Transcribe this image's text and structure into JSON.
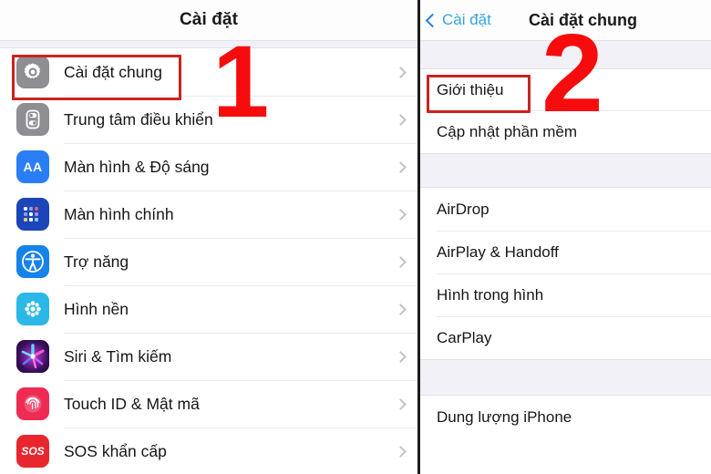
{
  "left_panel": {
    "nav": {
      "title": "Cài đặt"
    },
    "rows": [
      {
        "label": "Cài đặt chung",
        "icon": "gear-icon"
      },
      {
        "label": "Trung tâm điều khiển",
        "icon": "control-center-icon"
      },
      {
        "label": "Màn hình & Độ sáng",
        "icon": "display-brightness-icon",
        "icon_text": "AA"
      },
      {
        "label": "Màn hình chính",
        "icon": "home-screen-icon"
      },
      {
        "label": "Trợ năng",
        "icon": "accessibility-icon"
      },
      {
        "label": "Hình nền",
        "icon": "wallpaper-icon"
      },
      {
        "label": "Siri & Tìm kiếm",
        "icon": "siri-icon"
      },
      {
        "label": "Touch ID & Mật mã",
        "icon": "touch-id-icon"
      },
      {
        "label": "SOS khẩn cấp",
        "icon": "sos-icon",
        "icon_text": "SOS"
      }
    ]
  },
  "right_panel": {
    "nav": {
      "back_label": "Cài đặt",
      "title": "Cài đặt chung"
    },
    "sections": [
      {
        "rows": [
          {
            "label": "Giới thiệu"
          },
          {
            "label": "Cập nhật phần mềm"
          }
        ]
      },
      {
        "rows": [
          {
            "label": "AirDrop"
          },
          {
            "label": "AirPlay & Handoff"
          },
          {
            "label": "Hình trong hình"
          },
          {
            "label": "CarPlay"
          }
        ]
      },
      {
        "rows": [
          {
            "label": "Dung lượng iPhone"
          }
        ]
      }
    ]
  },
  "annotations": {
    "step_one": "1",
    "step_two": "2",
    "highlight_color": "#c9241f",
    "number_color": "#f60c0c"
  }
}
